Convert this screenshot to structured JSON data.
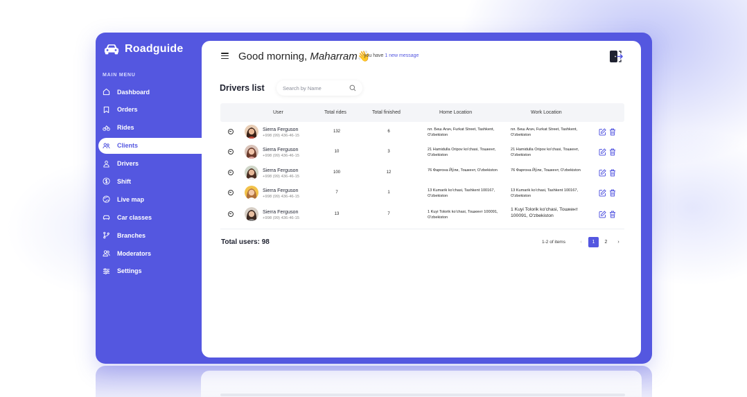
{
  "colors": {
    "accent": "#5457e0",
    "sidebar": "#5457e0",
    "panel": "#ffffff",
    "header_bg": "#f4f5f8"
  },
  "brand": {
    "name": "Roadguide",
    "icon": "car-icon"
  },
  "sidebar": {
    "section_title": "MAIN MENU",
    "items": [
      {
        "label": "Dashboard",
        "icon": "home-icon"
      },
      {
        "label": "Orders",
        "icon": "bookmark-icon"
      },
      {
        "label": "Rides",
        "icon": "bike-icon"
      },
      {
        "label": "Clients",
        "icon": "people-icon",
        "active": true
      },
      {
        "label": "Drivers",
        "icon": "driver-icon"
      },
      {
        "label": "Shift",
        "icon": "dollar-icon"
      },
      {
        "label": "Live map",
        "icon": "globe-icon"
      },
      {
        "label": "Car classes",
        "icon": "car-icon"
      },
      {
        "label": "Branches",
        "icon": "branch-icon"
      },
      {
        "label": "Moderators",
        "icon": "users-icon"
      },
      {
        "label": "Settings",
        "icon": "sliders-icon"
      }
    ]
  },
  "header": {
    "greeting": "Good morning, ",
    "user_name": "Maharram",
    "wave": "👋",
    "note_prefix": "you have ",
    "note_link": "1 new message",
    "logout_icon": "logout-icon"
  },
  "main": {
    "title": "Drivers list",
    "search_placeholder": "Search by Name",
    "columns": [
      "User",
      "Total rides",
      "Total finished",
      "Home Location",
      "Work Location"
    ],
    "rows": [
      {
        "name": "Sierra Ferguson",
        "phone": "+998 (99) 436-46-15",
        "total_rides": "132",
        "total_finished": "6",
        "home": "пл. Беш Агач, Furkat Street, Tashkent, O'zbekiston",
        "work": "пл. Беш Агач, Furkat Street, Tashkent, O'zbekiston",
        "work_big": false
      },
      {
        "name": "Sierra Ferguson",
        "phone": "+998 (99) 436-46-15",
        "total_rides": "10",
        "total_finished": "3",
        "home": "21 Hamidulla Oripov ko'chasi, Тошкент, O'zbekiston",
        "work": "21 Hamidulla Oripov ko'chasi, Тошкент, O'zbekiston",
        "work_big": false
      },
      {
        "name": "Sierra Ferguson",
        "phone": "+998 (99) 436-46-15",
        "total_rides": "100",
        "total_finished": "12",
        "home": "76 Фарғона Йўли, Тошкент, O'zbekiston",
        "work": "76 Фарғона Йўли, Тошкент, O'zbekiston",
        "work_big": false
      },
      {
        "name": "Sierra Ferguson",
        "phone": "+998 (99) 436-46-15",
        "total_rides": "7",
        "total_finished": "1",
        "home": "13 Kumarik ko'chasi, Tashkent 100167, O'zbekiston",
        "work": "13 Kumarik ko'chasi, Tashkent 100167, O'zbekiston",
        "work_big": false
      },
      {
        "name": "Sierra Ferguson",
        "phone": "+998 (99) 436-46-15",
        "total_rides": "13",
        "total_finished": "7",
        "home": "1 Kuyi Tolorik ko'chasi, Тошкент 100091, O'zbekiston",
        "work": "1 Kuyi Tolorik ko'chasi, Тошкент 100091, O'zbekiston",
        "work_big": true
      }
    ],
    "total_label": "Total users: 98",
    "pagination": {
      "info": "1-2 of items",
      "prev": "‹",
      "pages": [
        "1",
        "2"
      ],
      "next": "›"
    }
  }
}
